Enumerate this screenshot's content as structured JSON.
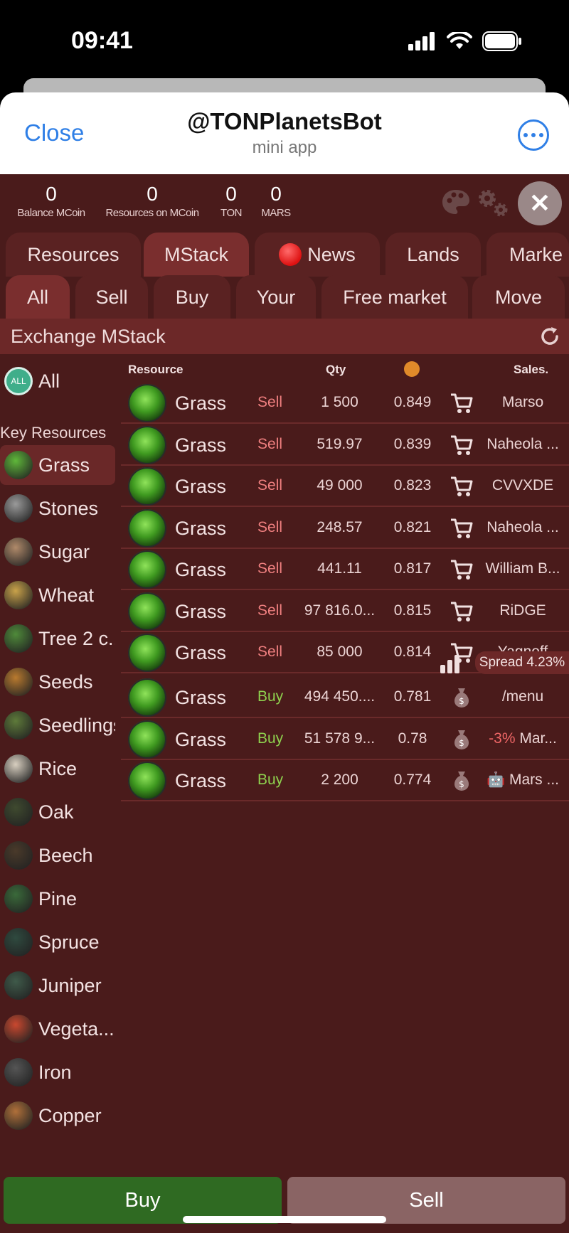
{
  "status_bar": {
    "time": "09:41"
  },
  "telegram": {
    "close_label": "Close",
    "title": "@TONPlanetsBot",
    "subtitle": "mini app"
  },
  "balances": [
    {
      "value": "0",
      "label": "Balance MCoin"
    },
    {
      "value": "0",
      "label": "Resources on MCoin"
    },
    {
      "value": "0",
      "label": "TON"
    },
    {
      "value": "0",
      "label": "MARS"
    }
  ],
  "tabs": [
    "Resources",
    "MStack",
    "News",
    "Lands",
    "Marke"
  ],
  "active_tab": "MStack",
  "subtabs": [
    "All",
    "Sell",
    "Buy",
    "Your",
    "Free market",
    "Move"
  ],
  "active_subtab": "All",
  "exchange_title": "Exchange MStack",
  "sidebar": {
    "all_label": "All",
    "section_header": "Key Resources",
    "items": [
      {
        "label": "Grass",
        "color": "#5fb83a"
      },
      {
        "label": "Stones",
        "color": "#9a9a9a"
      },
      {
        "label": "Sugar",
        "color": "#b08a6a"
      },
      {
        "label": "Wheat",
        "color": "#c9a24a"
      },
      {
        "label": "Tree 2 c...",
        "color": "#4f8a3a"
      },
      {
        "label": "Seeds",
        "color": "#b97a2f"
      },
      {
        "label": "Seedlings",
        "color": "#5e7a3a"
      },
      {
        "label": "Rice",
        "color": "#d8cfc0"
      },
      {
        "label": "Oak",
        "color": "#3f4a2f"
      },
      {
        "label": "Beech",
        "color": "#4a3a2a"
      },
      {
        "label": "Pine",
        "color": "#3a6a3a"
      },
      {
        "label": "Spruce",
        "color": "#2f4a3f"
      },
      {
        "label": "Juniper",
        "color": "#3f5a4a"
      },
      {
        "label": "Vegeta...",
        "color": "#c9482f"
      },
      {
        "label": "Iron",
        "color": "#555555"
      },
      {
        "label": "Copper",
        "color": "#b0703a"
      }
    ]
  },
  "table": {
    "headers": {
      "resource": "Resource",
      "qty": "Qty",
      "sales": "Sales."
    },
    "sell_rows": [
      {
        "name": "Grass",
        "type": "Sell",
        "qty": "1 500",
        "price": "0.849",
        "seller": "Marso"
      },
      {
        "name": "Grass",
        "type": "Sell",
        "qty": "519.97",
        "price": "0.839",
        "seller": "Naheola ..."
      },
      {
        "name": "Grass",
        "type": "Sell",
        "qty": "49 000",
        "price": "0.823",
        "seller": "CVVXDE"
      },
      {
        "name": "Grass",
        "type": "Sell",
        "qty": "248.57",
        "price": "0.821",
        "seller": "Naheola ..."
      },
      {
        "name": "Grass",
        "type": "Sell",
        "qty": "441.11",
        "price": "0.817",
        "seller": "William B..."
      },
      {
        "name": "Grass",
        "type": "Sell",
        "qty": "97 816.0...",
        "price": "0.815",
        "seller": "RiDGE"
      },
      {
        "name": "Grass",
        "type": "Sell",
        "qty": "85 000",
        "price": "0.814",
        "seller": "Yagnoff"
      }
    ],
    "spread": "Spread 4.23%",
    "buy_rows": [
      {
        "name": "Grass",
        "type": "Buy",
        "qty": "494 450....",
        "price": "0.781",
        "seller_prefix": "",
        "seller": "/menu"
      },
      {
        "name": "Grass",
        "type": "Buy",
        "qty": "51 578 9...",
        "price": "0.78",
        "seller_prefix": "-3%",
        "seller": "Mar..."
      },
      {
        "name": "Grass",
        "type": "Buy",
        "qty": "2 200",
        "price": "0.774",
        "seller_prefix": "🤖",
        "seller": "Mars ..."
      }
    ]
  },
  "buttons": {
    "buy": "Buy",
    "sell": "Sell"
  }
}
